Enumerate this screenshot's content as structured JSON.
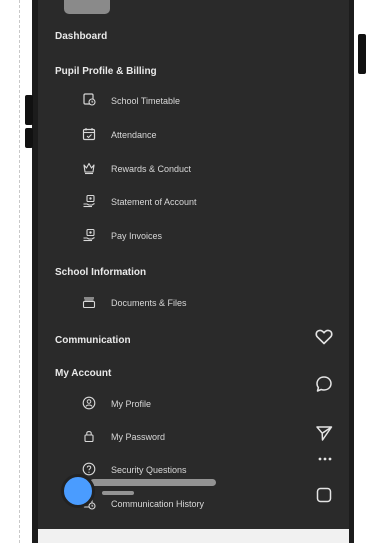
{
  "menu": {
    "dashboard": "Dashboard",
    "profile_billing": {
      "label": "Pupil Profile & Billing",
      "items": [
        {
          "label": "School Timetable",
          "icon": "timetable-icon"
        },
        {
          "label": "Attendance",
          "icon": "calendar-icon"
        },
        {
          "label": "Rewards & Conduct",
          "icon": "crown-icon"
        },
        {
          "label": "Statement of Account",
          "icon": "account-statement-icon"
        },
        {
          "label": "Pay Invoices",
          "icon": "pay-invoice-icon"
        }
      ]
    },
    "school_info": {
      "label": "School Information",
      "items": [
        {
          "label": "Documents & Files",
          "icon": "folder-icon"
        }
      ]
    },
    "communication": "Communication",
    "my_account": {
      "label": "My Account",
      "items": [
        {
          "label": "My Profile",
          "icon": "profile-icon"
        },
        {
          "label": "My Password",
          "icon": "lock-icon"
        },
        {
          "label": "Security Questions",
          "icon": "question-icon"
        },
        {
          "label": "Communication History",
          "icon": "history-icon"
        }
      ]
    }
  },
  "right_toolbar": [
    "heart-icon",
    "comment-icon",
    "send-icon",
    "more-icon",
    "bookmark-icon"
  ],
  "colors": {
    "background": "#2a2a2a",
    "text": "#e9e9e9",
    "fab": "#4a9cff"
  }
}
